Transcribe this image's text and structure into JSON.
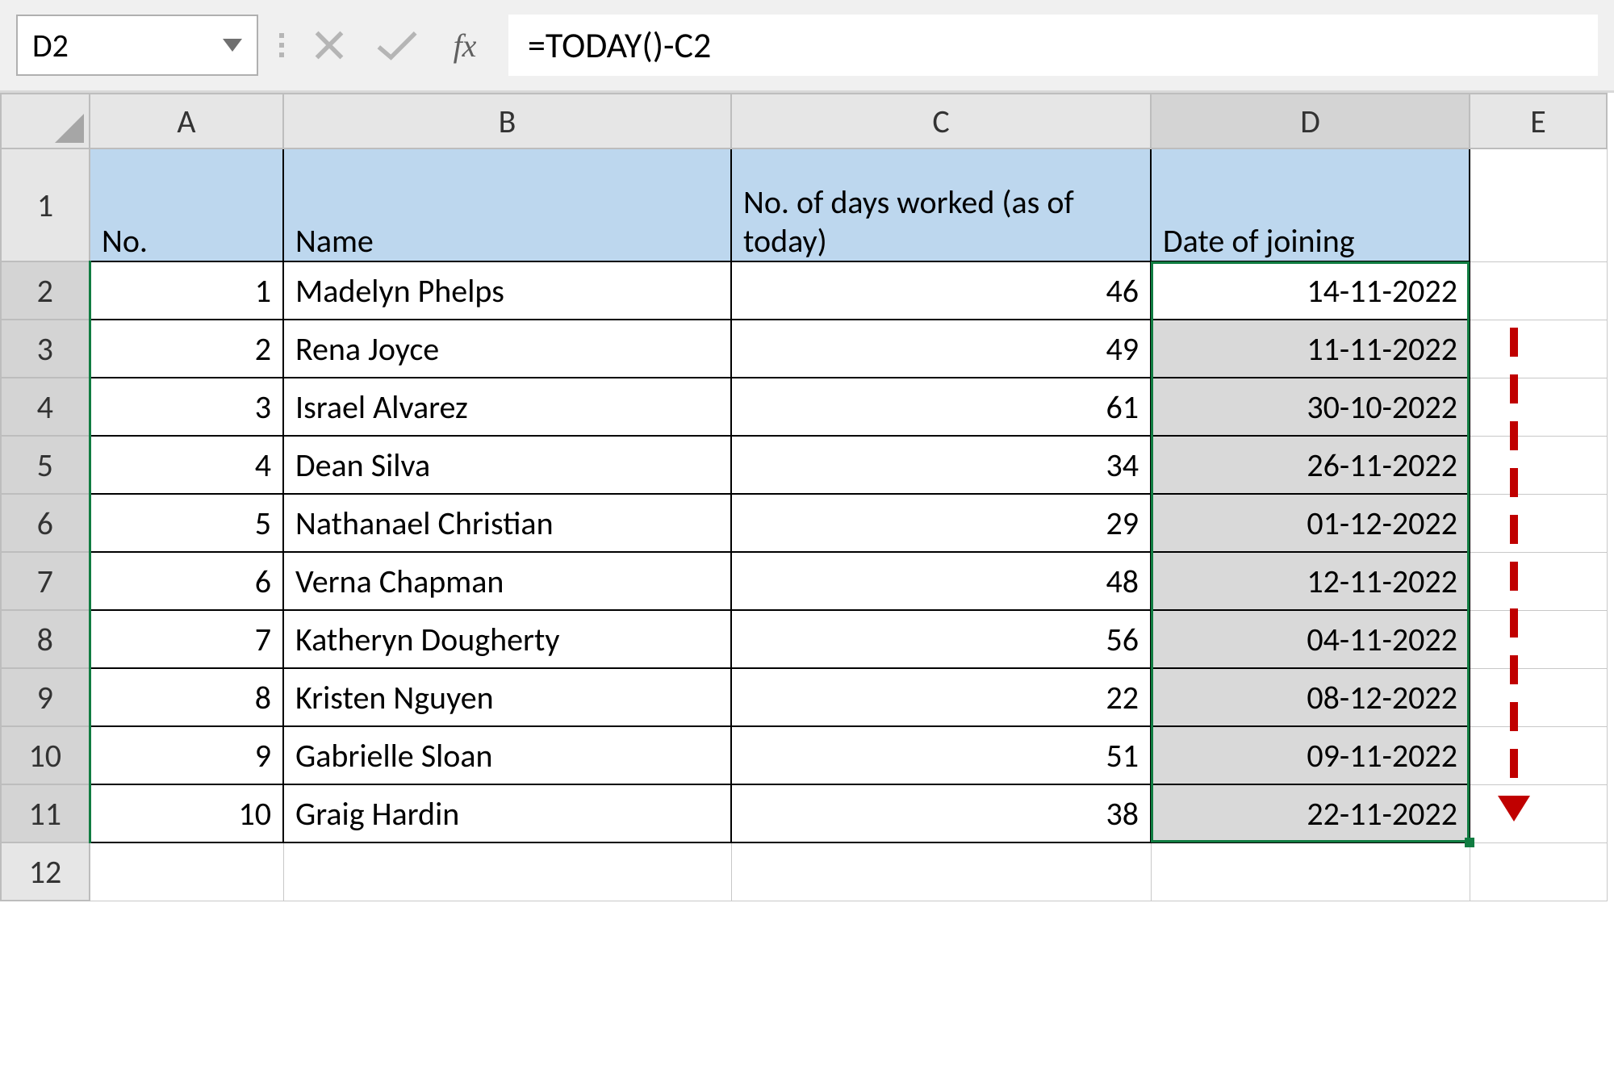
{
  "namebox": "D2",
  "formula": "=TODAY()-C2",
  "fx_label": "fx",
  "columns": {
    "A": "A",
    "B": "B",
    "C": "C",
    "D": "D",
    "E": "E"
  },
  "rows": {
    "r1": "1",
    "r2": "2",
    "r3": "3",
    "r4": "4",
    "r5": "5",
    "r6": "6",
    "r7": "7",
    "r8": "8",
    "r9": "9",
    "r10": "10",
    "r11": "11",
    "r12": "12"
  },
  "headers": {
    "no": "No.",
    "name": "Name",
    "days": "No. of days worked (as of today)",
    "doj": "Date of joining"
  },
  "table": [
    {
      "no": "1",
      "name": "Madelyn Phelps",
      "days": "46",
      "doj": "14-11-2022"
    },
    {
      "no": "2",
      "name": "Rena Joyce",
      "days": "49",
      "doj": "11-11-2022"
    },
    {
      "no": "3",
      "name": "Israel Alvarez",
      "days": "61",
      "doj": "30-10-2022"
    },
    {
      "no": "4",
      "name": "Dean Silva",
      "days": "34",
      "doj": "26-11-2022"
    },
    {
      "no": "5",
      "name": "Nathanael Christian",
      "days": "29",
      "doj": "01-12-2022"
    },
    {
      "no": "6",
      "name": "Verna Chapman",
      "days": "48",
      "doj": "12-11-2022"
    },
    {
      "no": "7",
      "name": "Katheryn Dougherty",
      "days": "56",
      "doj": "04-11-2022"
    },
    {
      "no": "8",
      "name": "Kristen Nguyen",
      "days": "22",
      "doj": "08-12-2022"
    },
    {
      "no": "9",
      "name": "Gabrielle Sloan",
      "days": "51",
      "doj": "09-11-2022"
    },
    {
      "no": "10",
      "name": "Graig Hardin",
      "days": "38",
      "doj": "22-11-2022"
    }
  ],
  "icons": {
    "cancel": "cancel-icon",
    "confirm": "confirm-icon"
  }
}
